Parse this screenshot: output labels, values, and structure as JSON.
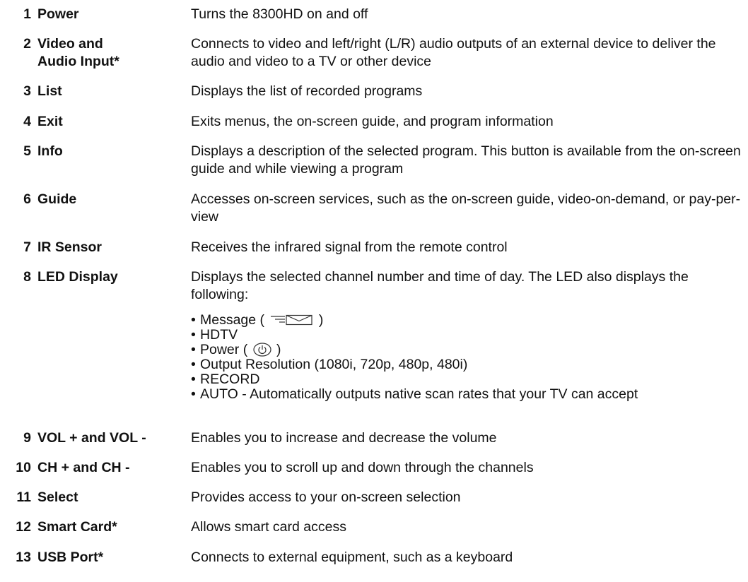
{
  "rows": [
    {
      "number": "1",
      "label": "Power",
      "description": "Turns the 8300HD on and off"
    },
    {
      "number": "2",
      "label": "Video and\nAudio Input*",
      "description": "Connects to video and left/right (L/R) audio outputs of an external device to deliver the audio and video to a TV or other device"
    },
    {
      "number": "3",
      "label": "List",
      "description": "Displays the list of recorded programs"
    },
    {
      "number": "4",
      "label": "Exit",
      "description": "Exits menus, the on-screen guide, and program information"
    },
    {
      "number": "5",
      "label": "Info",
      "description": "Displays a description of the selected program. This button is available from the on-screen guide and while viewing a program"
    },
    {
      "number": "6",
      "label": "Guide",
      "description": "Accesses on-screen services, such as the on-screen guide, video-on-demand, or pay-per-view"
    },
    {
      "number": "7",
      "label": "IR Sensor",
      "description": "Receives the infrared signal from the remote control"
    },
    {
      "number": "8",
      "label": "LED Display",
      "description": "Displays the selected channel number and time of day. The LED also displays the following:",
      "bullets": {
        "message_prefix": "Message (",
        "message_suffix": ")",
        "hdtv": "HDTV",
        "power_prefix": "Power  (",
        "power_suffix": ")",
        "output": "Output Resolution (1080i, 720p, 480p, 480i)",
        "record": "RECORD",
        "auto": "AUTO - Automatically outputs native scan rates that your TV can accept"
      },
      "icons": [
        "message-envelope-icon",
        "power-symbol-icon"
      ]
    },
    {
      "number": "9",
      "label": "VOL + and VOL -",
      "description": "Enables you to increase and decrease the volume"
    },
    {
      "number": "10",
      "label": "CH + and CH -",
      "description": "Enables you to scroll up and down through the channels"
    },
    {
      "number": "11",
      "label": "Select",
      "description": "Provides access to your on-screen selection"
    },
    {
      "number": "12",
      "label": "Smart Card*",
      "description": "Allows smart card access"
    },
    {
      "number": "13",
      "label": "USB Port*",
      "description": "Connects to external equipment, such as a keyboard"
    }
  ],
  "bullet_char": "•"
}
